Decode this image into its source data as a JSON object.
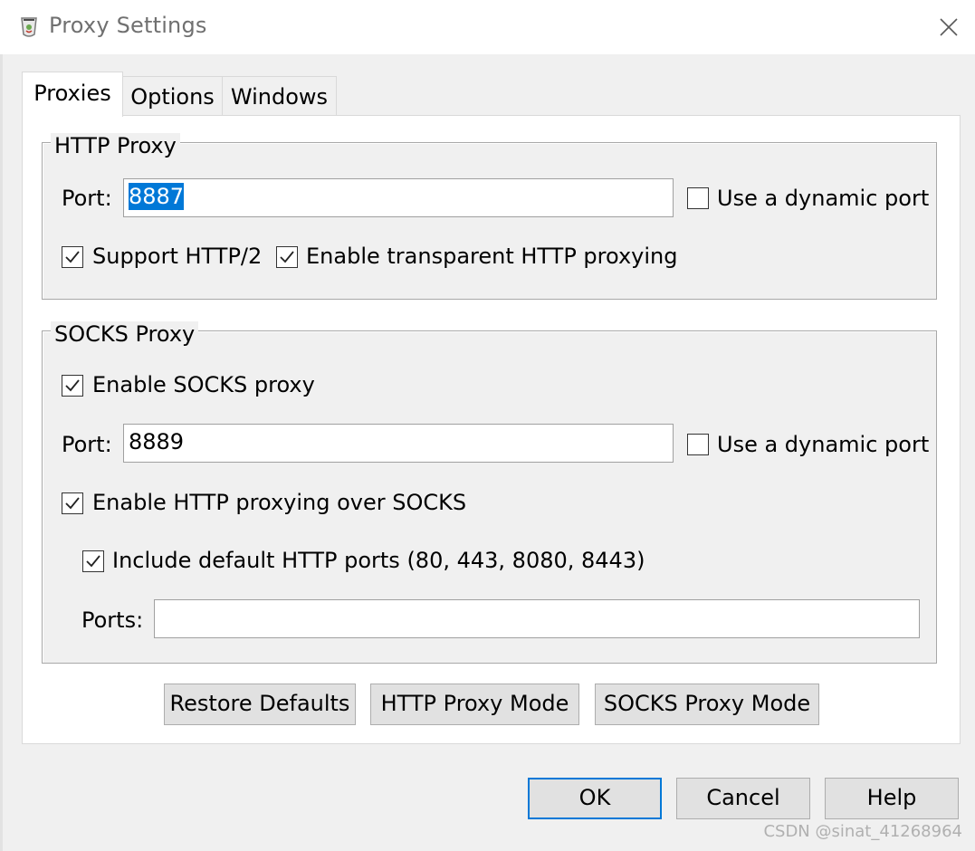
{
  "window": {
    "title": "Proxy Settings",
    "app_icon": "fiddler-app-icon",
    "close_icon": "close-icon"
  },
  "tabs": [
    {
      "label": "Proxies",
      "active": true
    },
    {
      "label": "Options",
      "active": false
    },
    {
      "label": "Windows",
      "active": false
    }
  ],
  "http_proxy": {
    "group_label": "HTTP Proxy",
    "port_label": "Port:",
    "port_value": "8887",
    "dynamic_port_label": "Use a dynamic port",
    "dynamic_port_checked": false,
    "support_http2_label": "Support HTTP/2",
    "support_http2_checked": true,
    "transparent_label": "Enable transparent HTTP proxying",
    "transparent_checked": true
  },
  "socks_proxy": {
    "group_label": "SOCKS Proxy",
    "enable_label": "Enable SOCKS proxy",
    "enable_checked": true,
    "port_label": "Port:",
    "port_value": "8889",
    "dynamic_port_label": "Use a dynamic port",
    "dynamic_port_checked": false,
    "http_over_socks_label": "Enable HTTP proxying over SOCKS",
    "http_over_socks_checked": true,
    "include_default_ports_label": "Include default HTTP ports (80, 443, 8080, 8443)",
    "include_default_ports_checked": true,
    "ports_label": "Ports:",
    "ports_value": ""
  },
  "panel_buttons": {
    "restore_defaults": "Restore Defaults",
    "http_proxy_mode": "HTTP Proxy Mode",
    "socks_proxy_mode": "SOCKS Proxy Mode"
  },
  "dialog_buttons": {
    "ok": "OK",
    "cancel": "Cancel",
    "help": "Help"
  },
  "watermark": "CSDN @sinat_41268964",
  "colors": {
    "selection": "#0078d7",
    "window_bg": "#f0f0f0",
    "button_bg": "#e1e1e1"
  }
}
